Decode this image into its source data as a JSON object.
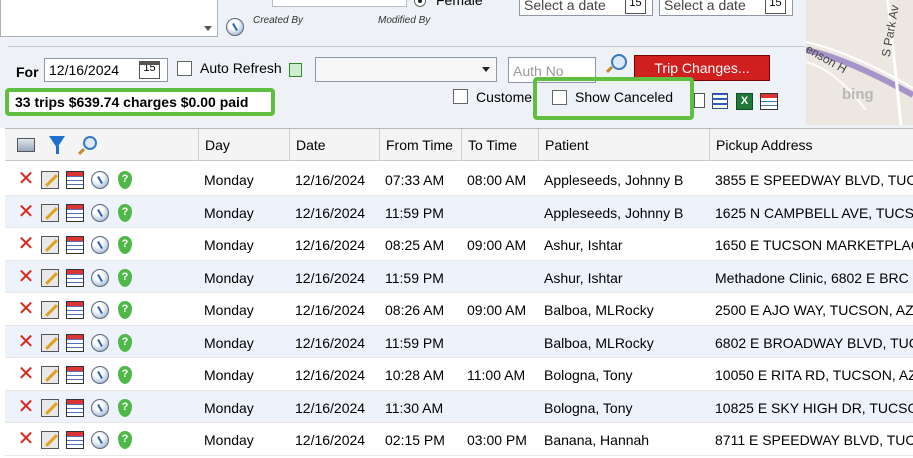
{
  "top_form": {
    "gender_option": "Female",
    "created_by_label": "Created By",
    "modified_by_label": "Modified By",
    "select_date_placeholder_1": "Select a date",
    "select_date_placeholder_2": "Select a date",
    "calendar_icon_text": "15"
  },
  "toolbar": {
    "for_label": "For",
    "date_value": "12/16/2024",
    "auto_refresh_label": "Auto Refresh",
    "auth_no_placeholder": "Auth No",
    "trip_changes_label": "Trip Changes...",
    "summary": "33 trips $639.74 charges $0.00 paid",
    "customer_label": "Custome",
    "show_canceled_label": "Show Canceled"
  },
  "map": {
    "street_label": "S Park Av",
    "street_label_2": "enson H",
    "bing_label": "bing"
  },
  "colors": {
    "highlight_green": "#5ebf41",
    "trip_button_red": "#d01f1f",
    "row_alt": "#eef3fb"
  },
  "grid": {
    "columns": [
      "Day",
      "Date",
      "From Time",
      "To Time",
      "Patient",
      "Pickup Address"
    ],
    "header_icons": [
      "settings-icon",
      "filter-icon",
      "search-icon"
    ],
    "row_icons": [
      "delete-icon",
      "edit-icon",
      "schedule-icon",
      "info-icon",
      "help-icon"
    ],
    "rows": [
      {
        "day": "Monday",
        "date": "12/16/2024",
        "from": "07:33 AM",
        "to": "08:00 AM",
        "patient": "Appleseeds, Johnny B",
        "pickup": "3855 E SPEEDWAY BLVD, TUCSC"
      },
      {
        "day": "Monday",
        "date": "12/16/2024",
        "from": "11:59 PM",
        "to": "",
        "patient": "Appleseeds, Johnny B",
        "pickup": "1625 N CAMPBELL AVE, TUCSO"
      },
      {
        "day": "Monday",
        "date": "12/16/2024",
        "from": "08:25 AM",
        "to": "09:00 AM",
        "patient": "Ashur, Ishtar",
        "pickup": "1650 E TUCSON MARKETPLAC"
      },
      {
        "day": "Monday",
        "date": "12/16/2024",
        "from": "11:59 PM",
        "to": "",
        "patient": "Ashur, Ishtar",
        "pickup": "Methadone Clinic, 6802 E BRC"
      },
      {
        "day": "Monday",
        "date": "12/16/2024",
        "from": "08:26 AM",
        "to": "09:00 AM",
        "patient": "Balboa, MLRocky",
        "pickup": "2500 E AJO WAY, TUCSON, AZ"
      },
      {
        "day": "Monday",
        "date": "12/16/2024",
        "from": "11:59 PM",
        "to": "",
        "patient": "Balboa, MLRocky",
        "pickup": "6802 E BROADWAY BLVD, TUC"
      },
      {
        "day": "Monday",
        "date": "12/16/2024",
        "from": "10:28 AM",
        "to": "11:00 AM",
        "patient": "Bologna, Tony",
        "pickup": "10050 E RITA RD, TUCSON, AZ"
      },
      {
        "day": "Monday",
        "date": "12/16/2024",
        "from": "11:30 AM",
        "to": "",
        "patient": "Bologna, Tony",
        "pickup": "10825 E SKY HIGH DR, TUCSO"
      },
      {
        "day": "Monday",
        "date": "12/16/2024",
        "from": "02:15 PM",
        "to": "03:00 PM",
        "patient": "Banana, Hannah",
        "pickup": "8711 E SPEEDWAY BLVD, TUCS"
      }
    ]
  }
}
